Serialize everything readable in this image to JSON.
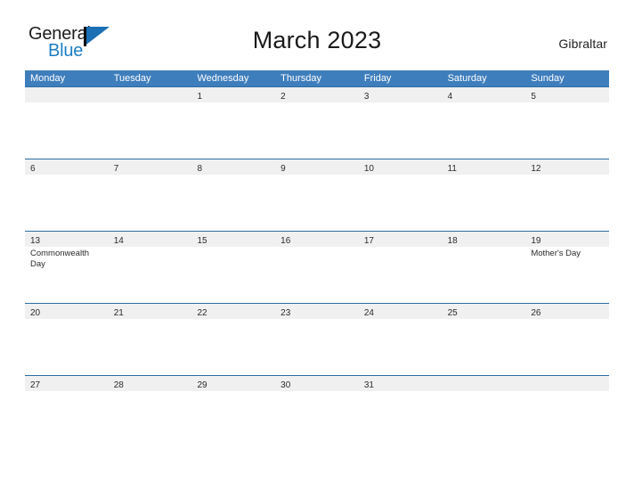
{
  "brand": {
    "word_one": "General",
    "word_two": "Blue",
    "flag_icon": "flag-icon",
    "flag_color": "#1b6fb4",
    "blue_text_color": "#1b7ec4"
  },
  "header": {
    "title": "March 2023",
    "location": "Gibraltar"
  },
  "colors": {
    "header_bar": "#3f7ebc",
    "row_divider": "#2b6ca3",
    "day_band": "#f0f0f0",
    "text": "#2b2b2b"
  },
  "calendar": {
    "weekdays": [
      "Monday",
      "Tuesday",
      "Wednesday",
      "Thursday",
      "Friday",
      "Saturday",
      "Sunday"
    ],
    "weeks": [
      [
        {
          "day": "",
          "events": []
        },
        {
          "day": "",
          "events": []
        },
        {
          "day": "1",
          "events": []
        },
        {
          "day": "2",
          "events": []
        },
        {
          "day": "3",
          "events": []
        },
        {
          "day": "4",
          "events": []
        },
        {
          "day": "5",
          "events": []
        }
      ],
      [
        {
          "day": "6",
          "events": []
        },
        {
          "day": "7",
          "events": []
        },
        {
          "day": "8",
          "events": []
        },
        {
          "day": "9",
          "events": []
        },
        {
          "day": "10",
          "events": []
        },
        {
          "day": "11",
          "events": []
        },
        {
          "day": "12",
          "events": []
        }
      ],
      [
        {
          "day": "13",
          "events": [
            "Commonwealth Day"
          ]
        },
        {
          "day": "14",
          "events": []
        },
        {
          "day": "15",
          "events": []
        },
        {
          "day": "16",
          "events": []
        },
        {
          "day": "17",
          "events": []
        },
        {
          "day": "18",
          "events": []
        },
        {
          "day": "19",
          "events": [
            "Mother's Day"
          ]
        }
      ],
      [
        {
          "day": "20",
          "events": []
        },
        {
          "day": "21",
          "events": []
        },
        {
          "day": "22",
          "events": []
        },
        {
          "day": "23",
          "events": []
        },
        {
          "day": "24",
          "events": []
        },
        {
          "day": "25",
          "events": []
        },
        {
          "day": "26",
          "events": []
        }
      ],
      [
        {
          "day": "27",
          "events": []
        },
        {
          "day": "28",
          "events": []
        },
        {
          "day": "29",
          "events": []
        },
        {
          "day": "30",
          "events": []
        },
        {
          "day": "31",
          "events": []
        },
        {
          "day": "",
          "events": []
        },
        {
          "day": "",
          "events": []
        }
      ]
    ]
  }
}
